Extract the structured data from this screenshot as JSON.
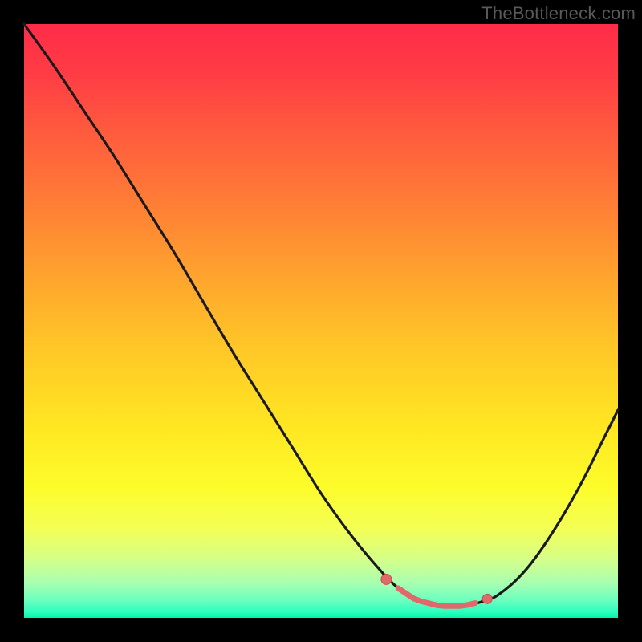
{
  "watermark": "TheBottleneck.com",
  "colors": {
    "background": "#000000",
    "curve": "#1a1a1a",
    "marker_fill": "#e06a6a",
    "marker_stroke": "#c84f4f"
  },
  "chart_data": {
    "type": "line",
    "title": "",
    "xlabel": "",
    "ylabel": "",
    "xlim": [
      0,
      100
    ],
    "ylim": [
      0,
      100
    ],
    "x": [
      0,
      5,
      10,
      15,
      20,
      25,
      30,
      35,
      40,
      45,
      50,
      55,
      60,
      63,
      66,
      70,
      74,
      78,
      80,
      83,
      86,
      90,
      94,
      97,
      100
    ],
    "values": [
      100,
      93,
      85.5,
      78,
      70,
      62,
      53.5,
      45,
      37,
      29,
      21,
      14,
      8,
      5,
      3,
      2,
      2,
      3,
      4,
      6.5,
      10,
      16,
      23,
      29,
      35
    ],
    "markers": [
      {
        "x": 61,
        "y": 6.5
      },
      {
        "x": 78,
        "y": 3.2
      }
    ],
    "flat_band_x": [
      63,
      76
    ],
    "note": "Curve is a bottleneck-style V shape: steep linear descent from x≈0 to x≈60, a shallow optimal trough around x≈63–76 (green zone), then rising toward x=100. Y values are read against the vertical color gradient where top=100 (red) and bottom=0 (green)."
  }
}
